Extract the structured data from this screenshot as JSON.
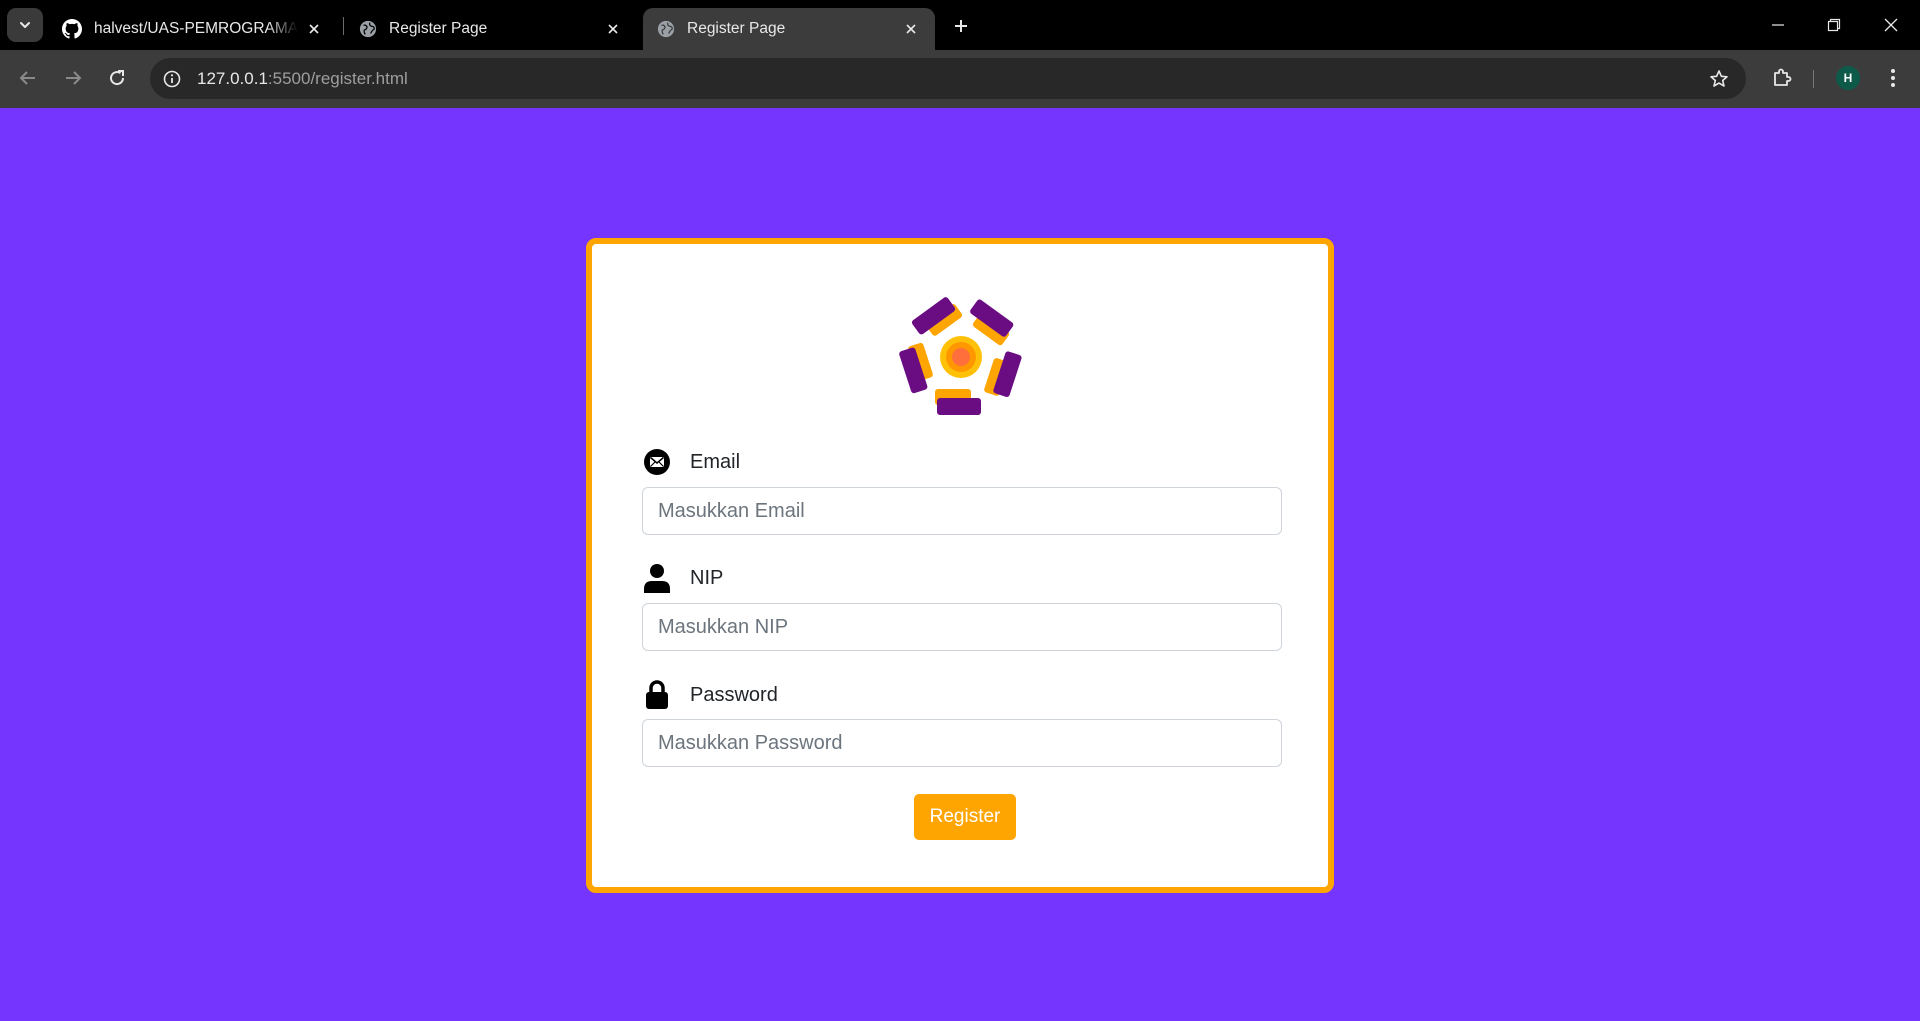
{
  "browser": {
    "tabs": [
      {
        "title": "halvest/UAS-PEMROGRAMAN-WEB",
        "icon": "github-icon",
        "active": false
      },
      {
        "title": "Register Page",
        "icon": "globe-icon",
        "active": false
      },
      {
        "title": "Register Page",
        "icon": "globe-icon",
        "active": true
      }
    ],
    "url_host": "127.0.0.1",
    "url_rest": ":5500/register.html",
    "profile_initial": "H"
  },
  "colors": {
    "page_background": "#7634FF",
    "accent": "#FFA502",
    "logo_purple": "#6A0D83"
  },
  "form": {
    "email": {
      "label": "Email",
      "placeholder": "Masukkan Email",
      "value": "",
      "icon": "envelope-icon"
    },
    "nip": {
      "label": "NIP",
      "placeholder": "Masukkan NIP",
      "value": "",
      "icon": "person-icon"
    },
    "password": {
      "label": "Password",
      "placeholder": "Masukkan Password",
      "value": "",
      "icon": "lock-icon"
    },
    "submit_label": "Register"
  }
}
